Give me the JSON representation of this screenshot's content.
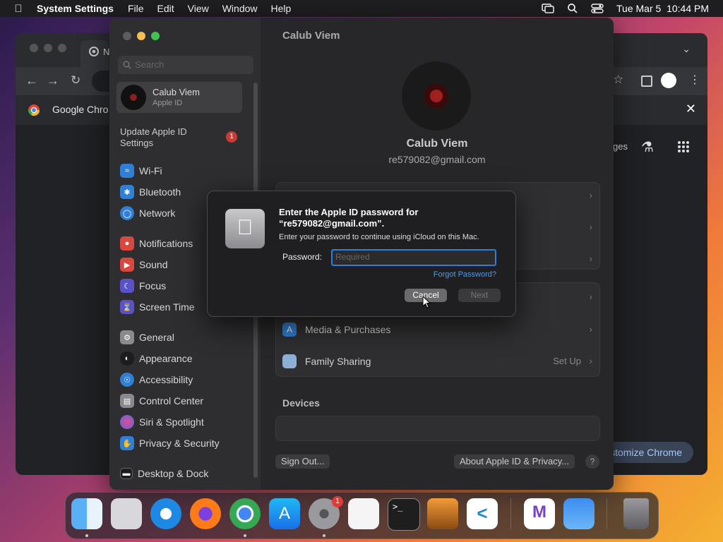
{
  "menubar": {
    "app_name": "System Settings",
    "menus": [
      "File",
      "Edit",
      "View",
      "Window",
      "Help"
    ],
    "datetime": "Tue Mar 5  10:44 PM"
  },
  "chrome": {
    "tab_label": "N",
    "notice_text": "Google Chro",
    "right_label": "ges",
    "customize_label": "ustomize Chrome"
  },
  "settings": {
    "window_title": "Calub Viem",
    "search_placeholder": "Search",
    "account": {
      "name": "Calub Viem",
      "subtitle": "Apple ID"
    },
    "update": {
      "label": "Update Apple ID Settings",
      "badge": "1"
    },
    "sidebar_items": [
      {
        "label": "Wi-Fi",
        "icon": "wifi-icon",
        "color": "#2f7fd6"
      },
      {
        "label": "Bluetooth",
        "icon": "bluetooth-icon",
        "color": "#2f7fd6"
      },
      {
        "label": "Network",
        "icon": "network-icon",
        "color": "#2f7fd6"
      },
      {
        "label": "Notifications",
        "icon": "bell-icon",
        "color": "#d9473f"
      },
      {
        "label": "Sound",
        "icon": "speaker-icon",
        "color": "#d9473f"
      },
      {
        "label": "Focus",
        "icon": "moon-icon",
        "color": "#5b52c9"
      },
      {
        "label": "Screen Time",
        "icon": "hourglass-icon",
        "color": "#5b52c9"
      },
      {
        "label": "General",
        "icon": "gear-icon",
        "color": "#8a8a8e"
      },
      {
        "label": "Appearance",
        "icon": "appearance-icon",
        "color": "#1c1c1e"
      },
      {
        "label": "Accessibility",
        "icon": "accessibility-icon",
        "color": "#2f7fd6"
      },
      {
        "label": "Control Center",
        "icon": "control-center-icon",
        "color": "#8a8a8e"
      },
      {
        "label": "Siri & Spotlight",
        "icon": "siri-icon",
        "color": "#b64cc9"
      },
      {
        "label": "Privacy & Security",
        "icon": "hand-icon",
        "color": "#2f7fd6"
      },
      {
        "label": "Desktop & Dock",
        "icon": "dock-icon",
        "color": "#1c1c1e"
      }
    ],
    "profile": {
      "name": "Calub Viem",
      "email": "re579082@gmail.com"
    },
    "rows": {
      "media": "Media & Purchases",
      "family": "Family Sharing",
      "family_value": "Set Up"
    },
    "devices_heading": "Devices",
    "sign_out": "Sign Out...",
    "about": "About Apple ID & Privacy...",
    "help": "?"
  },
  "dialog": {
    "title": "Enter the Apple ID password for “re579082@gmail.com”.",
    "message": "Enter your password to continue using iCloud on this Mac.",
    "password_label": "Password:",
    "password_placeholder": "Required",
    "forgot": "Forgot Password?",
    "cancel": "Cancel",
    "next": "Next"
  },
  "dock": {
    "apps": [
      "finder-icon",
      "launchpad-icon",
      "safari-icon",
      "firefox-icon",
      "chrome-icon",
      "app-store-icon",
      "system-settings-icon",
      "textedit-icon",
      "terminal-icon",
      "garageband-icon",
      "vscode-icon",
      "visual-studio-icon",
      "weather-icon",
      "trash-icon"
    ],
    "settings_badge": "1"
  }
}
